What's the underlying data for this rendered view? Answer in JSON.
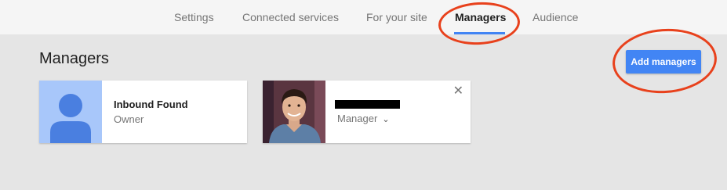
{
  "nav": {
    "tabs": [
      {
        "label": "Settings"
      },
      {
        "label": "Connected services"
      },
      {
        "label": "For your site"
      },
      {
        "label": "Managers",
        "active": true
      },
      {
        "label": "Audience"
      }
    ]
  },
  "page": {
    "title": "Managers",
    "add_button": "Add managers"
  },
  "managers": [
    {
      "name": "Inbound Found",
      "role": "Owner",
      "avatar": "default-person-icon"
    },
    {
      "name": "",
      "role": "Manager",
      "avatar": "profile-photo",
      "role_dropdown_icon": "chevron-down-icon",
      "remove_icon": "close-icon"
    }
  ],
  "colors": {
    "accent": "#4285f4",
    "annotation_ring": "#e8411c",
    "background": "#e5e5e5"
  }
}
